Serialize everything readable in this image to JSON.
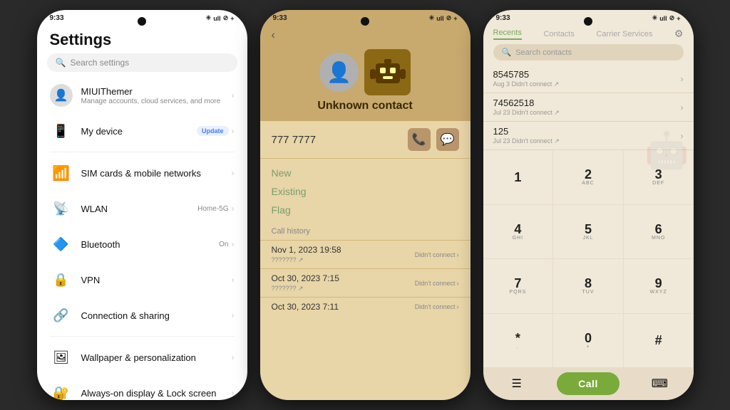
{
  "phone1": {
    "status": {
      "time": "9:33",
      "icons": "* ≋ ull ⊘ +"
    },
    "title": "Settings",
    "search_placeholder": "Search settings",
    "items": [
      {
        "id": "miui",
        "icon": "👤",
        "title": "MIUIThemer",
        "sub": "Manage accounts, cloud services, and more",
        "right": ""
      },
      {
        "id": "device",
        "icon": "📱",
        "title": "My device",
        "right": "Update",
        "badge": true
      },
      {
        "id": "sim",
        "icon": "📶",
        "title": "SIM cards & mobile networks",
        "right": ""
      },
      {
        "id": "wlan",
        "icon": "📡",
        "title": "WLAN",
        "right": "Home-5G"
      },
      {
        "id": "bluetooth",
        "icon": "🔷",
        "title": "Bluetooth",
        "right": "On"
      },
      {
        "id": "vpn",
        "icon": "🔒",
        "title": "VPN",
        "right": ""
      },
      {
        "id": "sharing",
        "icon": "🔗",
        "title": "Connection & sharing",
        "right": ""
      },
      {
        "id": "wallpaper",
        "icon": "🖼",
        "title": "Wallpaper & personalization",
        "right": ""
      },
      {
        "id": "aod",
        "icon": "🔐",
        "title": "Always-on display & Lock screen",
        "right": ""
      }
    ]
  },
  "phone2": {
    "status": {
      "time": "9:33",
      "icons": "* ≋ ull ⊘ +"
    },
    "contact_name": "Unknown contact",
    "phone_number": "777 7777",
    "options": [
      "New",
      "Existing",
      "Flag"
    ],
    "history_label": "Call history",
    "calls": [
      {
        "date": "Nov 1, 2023 19:58",
        "sub": "??????? ↗",
        "status": "Didn't connect"
      },
      {
        "date": "Oct 30, 2023 7:15",
        "sub": "??????? ↗",
        "status": "Didn't connect"
      },
      {
        "date": "Oct 30, 2023 7:11",
        "sub": "",
        "status": "Didn't connect"
      }
    ]
  },
  "phone3": {
    "status": {
      "time": "9:33",
      "icons": "* ≋ ull ⊘ +"
    },
    "tabs": [
      "Recents",
      "Contacts",
      "Carrier Services"
    ],
    "search_placeholder": "Search contacts",
    "recents": [
      {
        "number": "8545785",
        "sub": "Aug 3 Didn't connect ↗"
      },
      {
        "number": "74562518",
        "sub": "Jul 23 Didn't connect ↗"
      },
      {
        "number": "125",
        "sub": "Jul 23 Didn't connect ↗"
      }
    ],
    "dial_keys": [
      {
        "digit": "1",
        "alpha": ""
      },
      {
        "digit": "2",
        "alpha": "ABC"
      },
      {
        "digit": "3",
        "alpha": "DEF"
      },
      {
        "digit": "4",
        "alpha": "GHI"
      },
      {
        "digit": "5",
        "alpha": "JKL"
      },
      {
        "digit": "6",
        "alpha": "MNO"
      },
      {
        "digit": "7",
        "alpha": "PQRS"
      },
      {
        "digit": "8",
        "alpha": "TUV"
      },
      {
        "digit": "9",
        "alpha": "WXYZ"
      },
      {
        "digit": "*",
        "alpha": "."
      },
      {
        "digit": "0",
        "alpha": "+"
      },
      {
        "digit": "#",
        "alpha": ""
      }
    ],
    "call_label": "Call"
  }
}
